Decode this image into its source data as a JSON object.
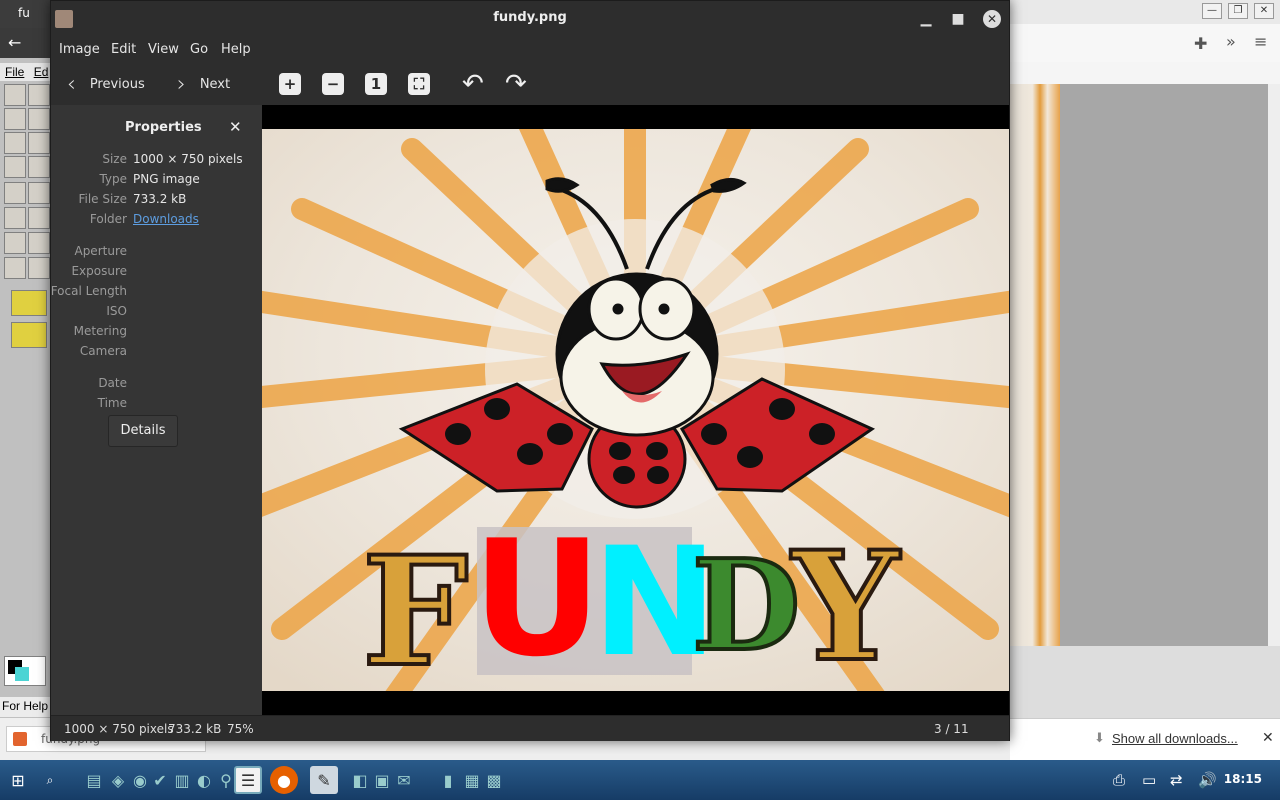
{
  "paint": {
    "title": "fu",
    "menu_file": "File",
    "menu_edit": "Ed",
    "status": "For Help"
  },
  "browser": {
    "download_link": "Show all downloads...",
    "download_chip": "fundy.png"
  },
  "viewer": {
    "title": "fundy.png",
    "menu": [
      "Image",
      "Edit",
      "View",
      "Go",
      "Help"
    ],
    "nav": {
      "previous": "Previous",
      "next": "Next"
    },
    "toolbar": {
      "zoom_in": "+",
      "zoom_out": "−",
      "actual_size": "1"
    },
    "properties": {
      "heading": "Properties",
      "rows": [
        {
          "label": "Size",
          "value": "1000 × 750 pixels"
        },
        {
          "label": "Type",
          "value": "PNG image"
        },
        {
          "label": "File Size",
          "value": "733.2 kB"
        },
        {
          "label": "Folder",
          "value": "Downloads"
        },
        {
          "label": "Aperture",
          "value": ""
        },
        {
          "label": "Exposure",
          "value": ""
        },
        {
          "label": "Focal Length",
          "value": ""
        },
        {
          "label": "ISO",
          "value": ""
        },
        {
          "label": "Metering",
          "value": ""
        },
        {
          "label": "Camera",
          "value": ""
        },
        {
          "label": "Date",
          "value": ""
        },
        {
          "label": "Time",
          "value": ""
        }
      ],
      "details_button": "Details"
    },
    "image_text": {
      "letters": [
        "F",
        "U",
        "N",
        "D",
        "Y"
      ]
    },
    "status": {
      "size": "1000 × 750 pixels",
      "file_size": "733.2 kB",
      "zoom": "75%",
      "position": "3 / 11"
    }
  },
  "taskbar": {
    "clock": "18:15"
  }
}
